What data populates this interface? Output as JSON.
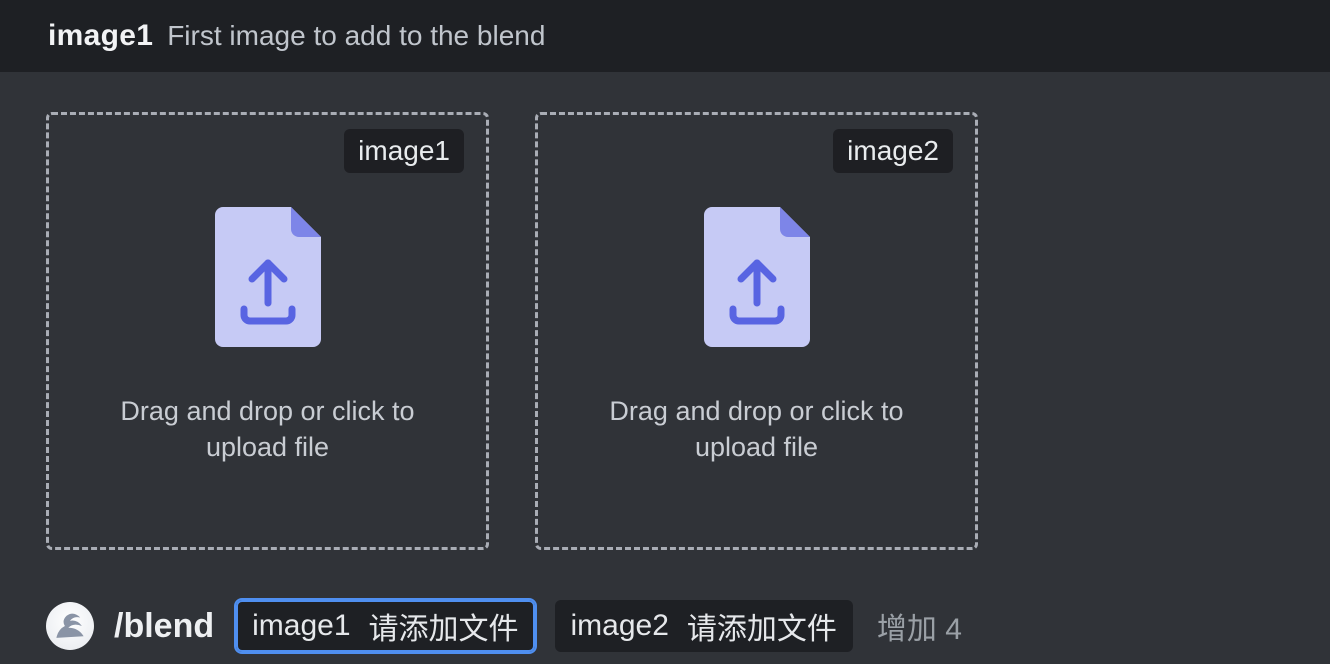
{
  "header": {
    "title": "image1",
    "description": "First image to add to the blend"
  },
  "upload": {
    "slots": [
      {
        "label": "image1",
        "hint": "Drag and drop or click to upload file"
      },
      {
        "label": "image2",
        "hint": "Drag and drop or click to upload file"
      }
    ]
  },
  "command": {
    "name": "/blend",
    "params": [
      {
        "key": "image1",
        "value": "请添加文件",
        "focused": true
      },
      {
        "key": "image2",
        "value": "请添加文件",
        "focused": false
      }
    ],
    "more_hint": "增加 4"
  }
}
